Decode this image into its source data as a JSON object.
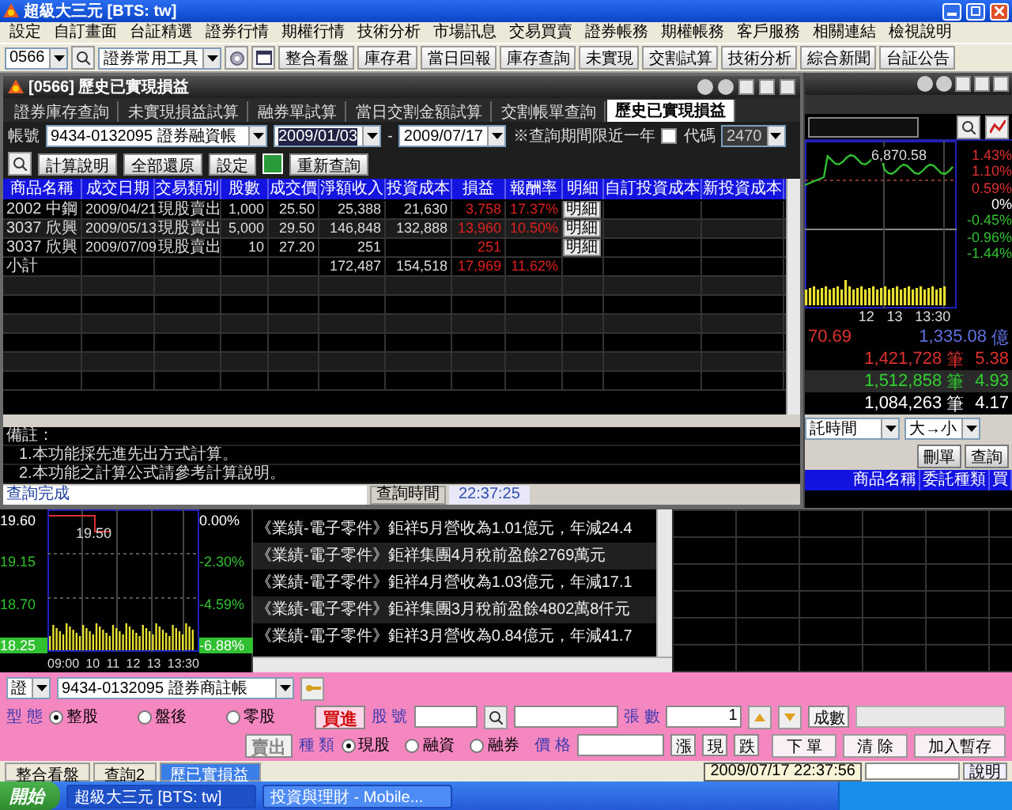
{
  "app": {
    "title": "超級大三元 [BTS: tw]"
  },
  "menu": [
    "設定",
    "自訂畫面",
    "台証精選",
    "證券行情",
    "期權行情",
    "技術分析",
    "市場訊息",
    "交易買賣",
    "證券帳務",
    "期權帳務",
    "客戶服務",
    "相關連結",
    "檢視說明"
  ],
  "toolbar": {
    "code": "0566",
    "tool_select": "證券常用工具",
    "buttons": [
      "整合看盤",
      "庫存君",
      "當日回報",
      "庫存查詢",
      "未實現",
      "交割試算",
      "技術分析",
      "綜合新聞",
      "台証公告"
    ]
  },
  "dialog": {
    "title": "[0566] 歷史已實現損益",
    "tabs": [
      {
        "label": "證券庫存查詢",
        "selected": false
      },
      {
        "label": "未實現損益試算",
        "selected": false
      },
      {
        "label": "融券單試算",
        "selected": false
      },
      {
        "label": "當日交割金額試算",
        "selected": false
      },
      {
        "label": "交割帳單查詢",
        "selected": false
      },
      {
        "label": "歷史已實現損益",
        "selected": true
      }
    ],
    "filter": {
      "account_label": "帳號",
      "account": "9434-0132095 證券融資帳",
      "start_date": "2009/01/03",
      "date_separator": "-",
      "end_date": "2009/07/17",
      "period_note": "※查詢期間限近一年",
      "code_filter": {
        "label": "代碼",
        "checked": false,
        "value": "2470"
      },
      "buttons": [
        "計算說明",
        "全部還原",
        "設定",
        "重新查詢"
      ]
    },
    "table": {
      "columns": [
        "商品名稱",
        "成交日期",
        "交易類別",
        "股數",
        "成交價",
        "淨額收入",
        "投資成本",
        "損益",
        "報酬率",
        "明細",
        "自訂投資成本",
        "新投資成本"
      ],
      "rows": [
        {
          "product": "2002 中鋼",
          "date": "2009/04/21",
          "trade_type": "現股賣出",
          "shares": "1,000",
          "price": "25.50",
          "net_income": "25,388",
          "cost": "21,630",
          "profit": "3,758",
          "return": "17.37%",
          "detail": "明細"
        },
        {
          "product": "3037 欣興",
          "date": "2009/05/13",
          "trade_type": "現股賣出",
          "shares": "5,000",
          "price": "29.50",
          "net_income": "146,848",
          "cost": "132,888",
          "profit": "13,960",
          "return": "10.50%",
          "detail": "明細"
        },
        {
          "product": "3037 欣興",
          "date": "2009/07/09",
          "trade_type": "現股賣出",
          "shares": "10",
          "price": "27.20",
          "net_income": "251",
          "cost": "",
          "profit": "251",
          "return": "",
          "detail": "明細"
        }
      ],
      "subtotal": {
        "label": "小計",
        "net_income": "172,487",
        "cost": "154,518",
        "profit": "17,969",
        "return": "11.62%"
      }
    },
    "notes": [
      "備註：",
      "1.本功能採先進先出方式計算。",
      "2.本功能之計算公式請參考計算說明。"
    ],
    "status": {
      "message": "查詢完成",
      "time_label": "查詢時間",
      "time": "22:37:25"
    }
  },
  "index_panel": {
    "last_label": "6,870.58",
    "y_labels": [
      {
        "text": "1.43%",
        "color": "#e03030"
      },
      {
        "text": "1.10%",
        "color": "#e03030"
      },
      {
        "text": "0.59%",
        "color": "#e03030"
      },
      {
        "text": "0%",
        "color": "#ffffff"
      },
      {
        "text": "-0.45%",
        "color": "#30c030"
      },
      {
        "text": "-0.96%",
        "color": "#30c030"
      },
      {
        "text": "-1.44%",
        "color": "#30c030"
      }
    ],
    "x_labels": [
      "12",
      "13",
      "13:30"
    ],
    "stats": [
      {
        "lead": "70.69",
        "value": "1,335.08",
        "unit": "億",
        "color": "#6070e0"
      },
      {
        "value": "1,421,728",
        "unit": "筆",
        "ratio": "5.38",
        "color": "#e03030"
      },
      {
        "value": "1,512,858",
        "unit": "筆",
        "ratio": "4.93",
        "color": "#30d030"
      },
      {
        "value": "1,084,263",
        "unit": "筆",
        "ratio": "4.17",
        "color": "#ffffff"
      }
    ],
    "sort": {
      "field": "託時間",
      "order": "大→小"
    },
    "buttons": [
      "刪單",
      "查詢"
    ],
    "order_columns": [
      "商品名稱",
      "委託種類",
      "買"
    ]
  },
  "stock_chart": {
    "price_labels": [
      {
        "text": "19.60",
        "color": "#ffffff"
      },
      {
        "text": "19.15",
        "color": "#30c030"
      },
      {
        "text": "18.70",
        "color": "#30c030"
      },
      {
        "text": "18.25",
        "color": "#30c030"
      }
    ],
    "pct_labels": [
      {
        "text": "0.00%",
        "color": "#ffffff"
      },
      {
        "text": "-2.30%",
        "color": "#30c030"
      },
      {
        "text": "-4.59%",
        "color": "#30c030"
      },
      {
        "text": "-6.88%",
        "color": "#30c030"
      }
    ],
    "marker": "19.50",
    "x_labels": [
      "09:00",
      "10",
      "11",
      "12",
      "13",
      "13:30"
    ]
  },
  "news": [
    "《業績-電子零件》鉅祥5月營收為1.01億元，年減24.4",
    "《業績-電子零件》鉅祥集團4月稅前盈餘2769萬元",
    "《業績-電子零件》鉅祥4月營收為1.03億元，年減17.1",
    "《業績-電子零件》鉅祥集團3月稅前盈餘4802萬8仟元",
    "《業績-電子零件》鉅祥3月營收為0.84億元，年減41.7"
  ],
  "order": {
    "market": "證",
    "account": "9434-0132095 證券商註帳",
    "board_label": "型 態",
    "board_options": [
      {
        "label": "整股",
        "selected": true
      },
      {
        "label": "盤後",
        "selected": false
      },
      {
        "label": "零股",
        "selected": false
      }
    ],
    "sides": [
      {
        "label": "買進",
        "selected": true
      },
      {
        "label": "賣出",
        "selected": false
      }
    ],
    "stock_label": "股 號",
    "kind_label": "種 類",
    "kind_options": [
      {
        "label": "現股",
        "selected": true
      },
      {
        "label": "融資",
        "selected": false
      },
      {
        "label": "融券",
        "selected": false
      }
    ],
    "qty_label": "張 數",
    "qty": "1",
    "price_label": "價 格",
    "price_buttons": [
      "漲",
      "現",
      "跌"
    ],
    "ratio_button": "成數",
    "actions": [
      "下 單",
      "清 除",
      "加入暫存"
    ]
  },
  "bottom_tabs": [
    {
      "label": "整合看盤",
      "selected": false
    },
    {
      "label": "查詢2",
      "selected": false
    },
    {
      "label": "歷已實損益",
      "selected": true
    }
  ],
  "datetime": "2009/07/17 22:37:56",
  "help_button": "說明",
  "taskbar": {
    "start": "開始",
    "tasks": [
      {
        "label": "超級大三元 [BTS: tw]",
        "selected": false
      },
      {
        "label": "投資與理財 - Mobile...",
        "selected": true
      }
    ]
  }
}
